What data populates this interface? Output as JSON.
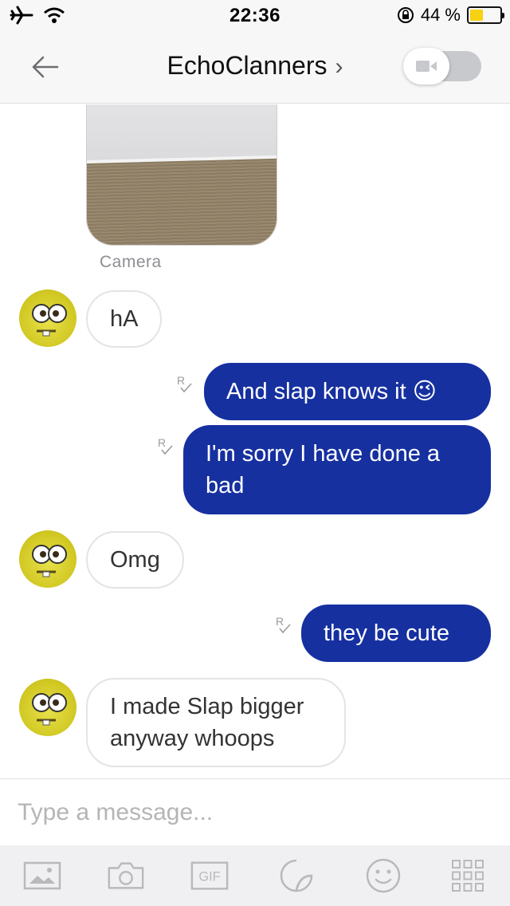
{
  "status_bar": {
    "time": "22:36",
    "battery_label": "44 %",
    "battery_level": 0.44
  },
  "header": {
    "title": "EchoClanners",
    "chevron": "›"
  },
  "photo_message": {
    "caption": "Camera"
  },
  "messages": [
    {
      "direction": "in",
      "text": "hA"
    },
    {
      "direction": "out",
      "text": "And slap knows it 😉",
      "receipt": "R"
    },
    {
      "direction": "out",
      "text": "I'm sorry I have done a bad",
      "receipt": "R"
    },
    {
      "direction": "in",
      "text": "Omg"
    },
    {
      "direction": "out",
      "text": "they be cute",
      "receipt": "R"
    },
    {
      "direction": "in",
      "text": "I made Slap bigger anyway whoops"
    }
  ],
  "composer": {
    "placeholder": "Type a message..."
  },
  "toolbar": {
    "items": [
      "image-icon",
      "camera-icon",
      "gif-icon",
      "sticker-icon",
      "emoji-icon",
      "apps-grid-icon"
    ],
    "gif_label": "GIF"
  },
  "colors": {
    "outgoing_bubble": "#1630a0",
    "incoming_border": "#e4e4e6",
    "toolbar_icon": "#b8b9bd"
  }
}
